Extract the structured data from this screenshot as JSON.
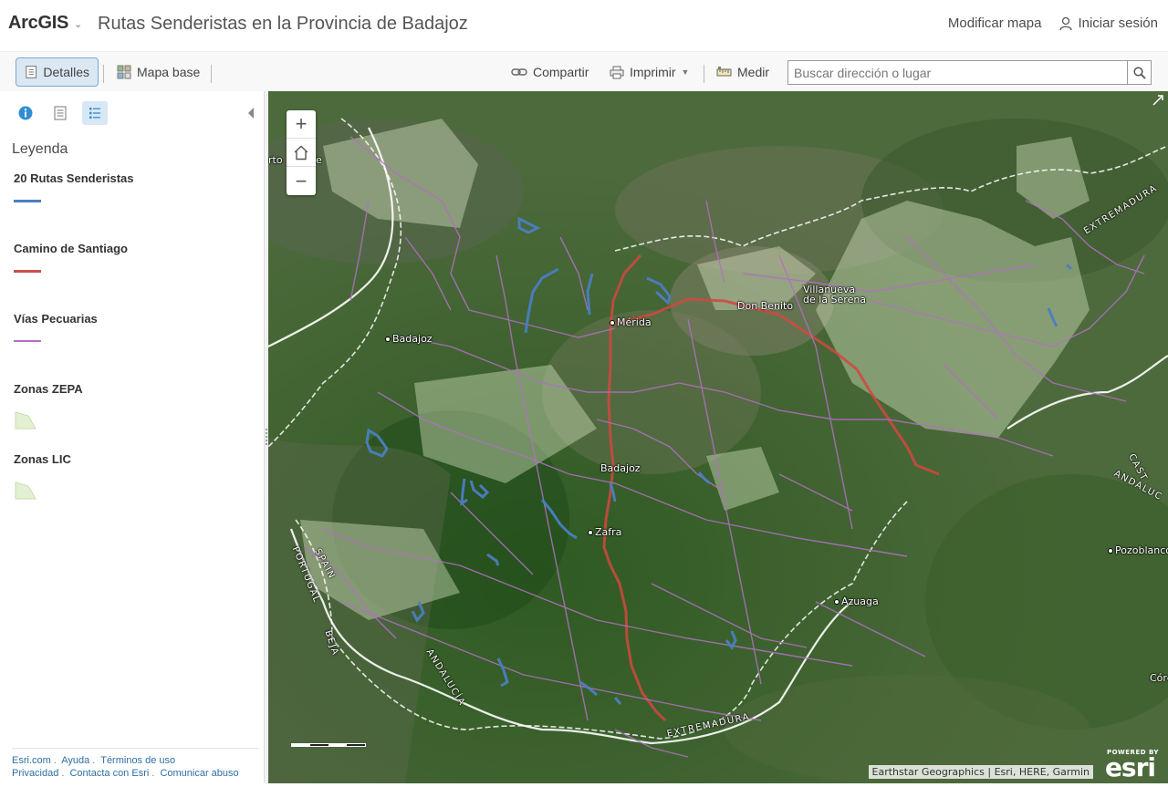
{
  "header": {
    "logo": "ArcGIS",
    "title": "Rutas Senderistas en la Provincia de Badajoz",
    "modify_map": "Modificar mapa",
    "sign_in": "Iniciar sesión"
  },
  "toolbar": {
    "details": "Detalles",
    "basemap": "Mapa base",
    "share": "Compartir",
    "print": "Imprimir",
    "measure": "Medir",
    "search_placeholder": "Buscar dirección o lugar"
  },
  "panel": {
    "legend_title": "Leyenda",
    "legend": [
      {
        "label": "20 Rutas Senderistas",
        "symbol": "line",
        "color": "#4a7fc1"
      },
      {
        "label": "Camino de Santiago",
        "symbol": "line",
        "color": "#c9504a"
      },
      {
        "label": "Vías Pecuarias",
        "symbol": "line",
        "color": "#b36fc4"
      },
      {
        "label": "Zonas ZEPA",
        "symbol": "polygon",
        "color": "#e4f0d2"
      },
      {
        "label": "Zonas LIC",
        "symbol": "polygon",
        "color": "#e4f0d2"
      }
    ],
    "footer": {
      "esri": "Esri.com",
      "help": "Ayuda",
      "terms": "Términos de uso",
      "privacy": "Privacidad",
      "contact": "Contacta con Esri",
      "report": "Comunicar abuso"
    }
  },
  "map": {
    "places": {
      "merida": "Mérida",
      "badajoz_city": "Badajoz",
      "badajoz_label": "Badajoz",
      "don_benito": "Don Benito",
      "villanueva": "Villanueva",
      "villanueva2": "de la Serena",
      "zafra": "Zafra",
      "azuaga": "Azuaga",
      "pozoblanco": "Pozoblanco",
      "cordoba_partial": "Córd",
      "portalegre_partial": "rto",
      "portalegre_partial2": "e"
    },
    "boundaries": {
      "extremadura_ne": "EXTREMADURA",
      "extremadura_s": "EXTREMADURA",
      "portugal": "PORTUGAL",
      "spain": "SPAIN",
      "andalucia_w": "ANDALUCÍA",
      "andalucia_e": "ANDALUC",
      "castilla": "CAST",
      "beja": "BEJA"
    },
    "attribution": "Earthstar Geographics | Esri, HERE, Garmin",
    "powered_by": "POWERED BY",
    "esri": "esri"
  }
}
